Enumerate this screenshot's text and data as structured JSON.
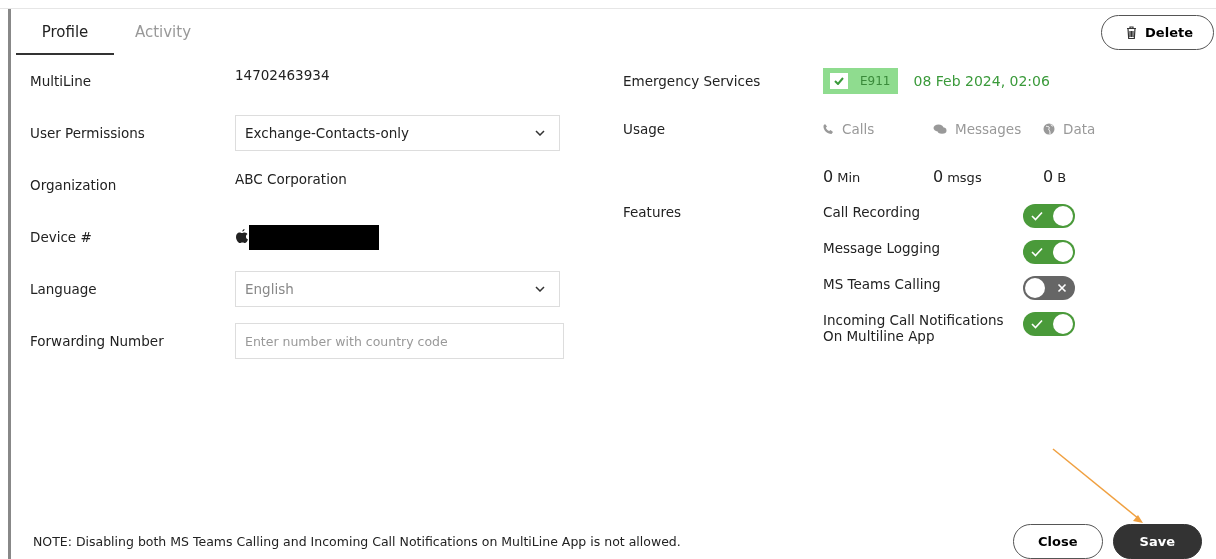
{
  "tabs": [
    {
      "label": "Profile",
      "selected": true
    },
    {
      "label": "Activity",
      "selected": false
    }
  ],
  "delete_button": {
    "label": "Delete"
  },
  "left_fields": [
    {
      "label": "MultiLine",
      "kind": "text",
      "value": "14702463934"
    },
    {
      "label": "User Permissions",
      "kind": "select",
      "value": "Exchange-Contacts-only",
      "disabled": false
    },
    {
      "label": "Organization",
      "kind": "text",
      "value": "ABC Corporation"
    },
    {
      "label": "Device #",
      "kind": "device"
    },
    {
      "label": "Language",
      "kind": "select",
      "value": "English",
      "disabled": true
    },
    {
      "label": "Forwarding Number",
      "kind": "input",
      "placeholder": "Enter number with country code"
    }
  ],
  "emergency": {
    "label": "Emergency Services",
    "checked": true,
    "badge": "E911",
    "date": "08 Feb 2024, 02:06"
  },
  "usage": {
    "label": "Usage",
    "columns": [
      {
        "kind": "calls",
        "label": "Calls",
        "amount": "0",
        "unit": "Min"
      },
      {
        "kind": "messages",
        "label": "Messages",
        "amount": "0",
        "unit": "msgs"
      },
      {
        "kind": "data",
        "label": "Data",
        "amount": "0",
        "unit": "B"
      }
    ]
  },
  "features": {
    "label": "Features",
    "items": [
      {
        "label": "Call Recording",
        "on": true
      },
      {
        "label": "Message Logging",
        "on": true
      },
      {
        "label": "MS Teams Calling",
        "on": false
      },
      {
        "label": "Incoming Call Notifications On Multiline App",
        "on": true
      }
    ]
  },
  "note": "NOTE: Disabling both MS Teams Calling and Incoming Call Notifications on MultiLine App is not allowed.",
  "buttons": [
    {
      "label": "Close",
      "kind": "secondary"
    },
    {
      "label": "Save",
      "kind": "primary"
    }
  ]
}
